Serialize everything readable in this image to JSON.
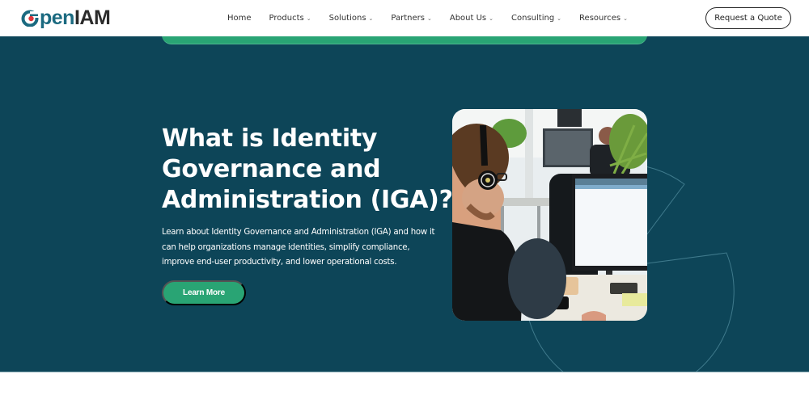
{
  "header": {
    "logo": {
      "prefix": "O",
      "pen": "pen",
      "iam": "IAM",
      "alt": "OpenIAM"
    },
    "nav": [
      {
        "label": "Home",
        "has_dropdown": false
      },
      {
        "label": "Products",
        "has_dropdown": true
      },
      {
        "label": "Solutions",
        "has_dropdown": true
      },
      {
        "label": "Partners",
        "has_dropdown": true
      },
      {
        "label": "About Us",
        "has_dropdown": true
      },
      {
        "label": "Consulting",
        "has_dropdown": true
      },
      {
        "label": "Resources",
        "has_dropdown": true
      }
    ],
    "dropdown_icon": "chevron-down-icon",
    "cta_label": "Request a Quote"
  },
  "hero": {
    "title": "What is Identity Governance and Administration (IGA)?",
    "description": "Learn about Identity Governance and Administration (IGA) and how it can help organizations manage identities, simplify compliance, improve end-user productivity, and lower operational costs.",
    "button_label": "Learn More",
    "image_alt": "Developer wearing headphones working at a computer in an office"
  },
  "colors": {
    "brand_teal": "#1b6a80",
    "hero_background": "#0d4558",
    "accent_green": "#29a474",
    "logo_red": "#e0353b"
  }
}
